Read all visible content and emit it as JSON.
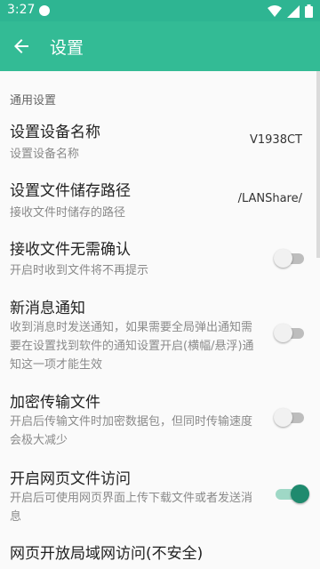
{
  "status_bar": {
    "time": "3:27"
  },
  "app_bar": {
    "title": "设置"
  },
  "section": {
    "header": "通用设置"
  },
  "items": [
    {
      "title": "设置设备名称",
      "subtitle": "设置设备名称",
      "value": "V1938CT"
    },
    {
      "title": "设置文件储存路径",
      "subtitle": "接收文件时储存的路径",
      "value": "/LANShare/"
    },
    {
      "title": "接收文件无需确认",
      "subtitle": "开启时收到文件将不再提示",
      "enabled": false
    },
    {
      "title": "新消息通知",
      "subtitle": "收到消息时发送通知，如果需要全局弹出通知需要在设置找到软件的通知设置开启(横幅/悬浮)通知这一项才能生效",
      "enabled": false
    },
    {
      "title": "加密传输文件",
      "subtitle": "开启后传输文件时加密数据包，但同时传输速度会极大减少",
      "enabled": false
    },
    {
      "title": "开启网页文件访问",
      "subtitle": "开启后可使用网页界面上传下载文件或者发送消息",
      "enabled": true
    },
    {
      "title": "网页开放局域网访问(不安全)"
    }
  ],
  "colors": {
    "accent": "#33bb95",
    "status_bar": "#2eb592",
    "switch_on": "#1f8a6e"
  },
  "icons": {
    "back": "arrow-left-icon",
    "notification": "circle-icon",
    "wifi": "wifi-icon",
    "cell": "cell-signal-icon",
    "battery": "battery-icon"
  }
}
